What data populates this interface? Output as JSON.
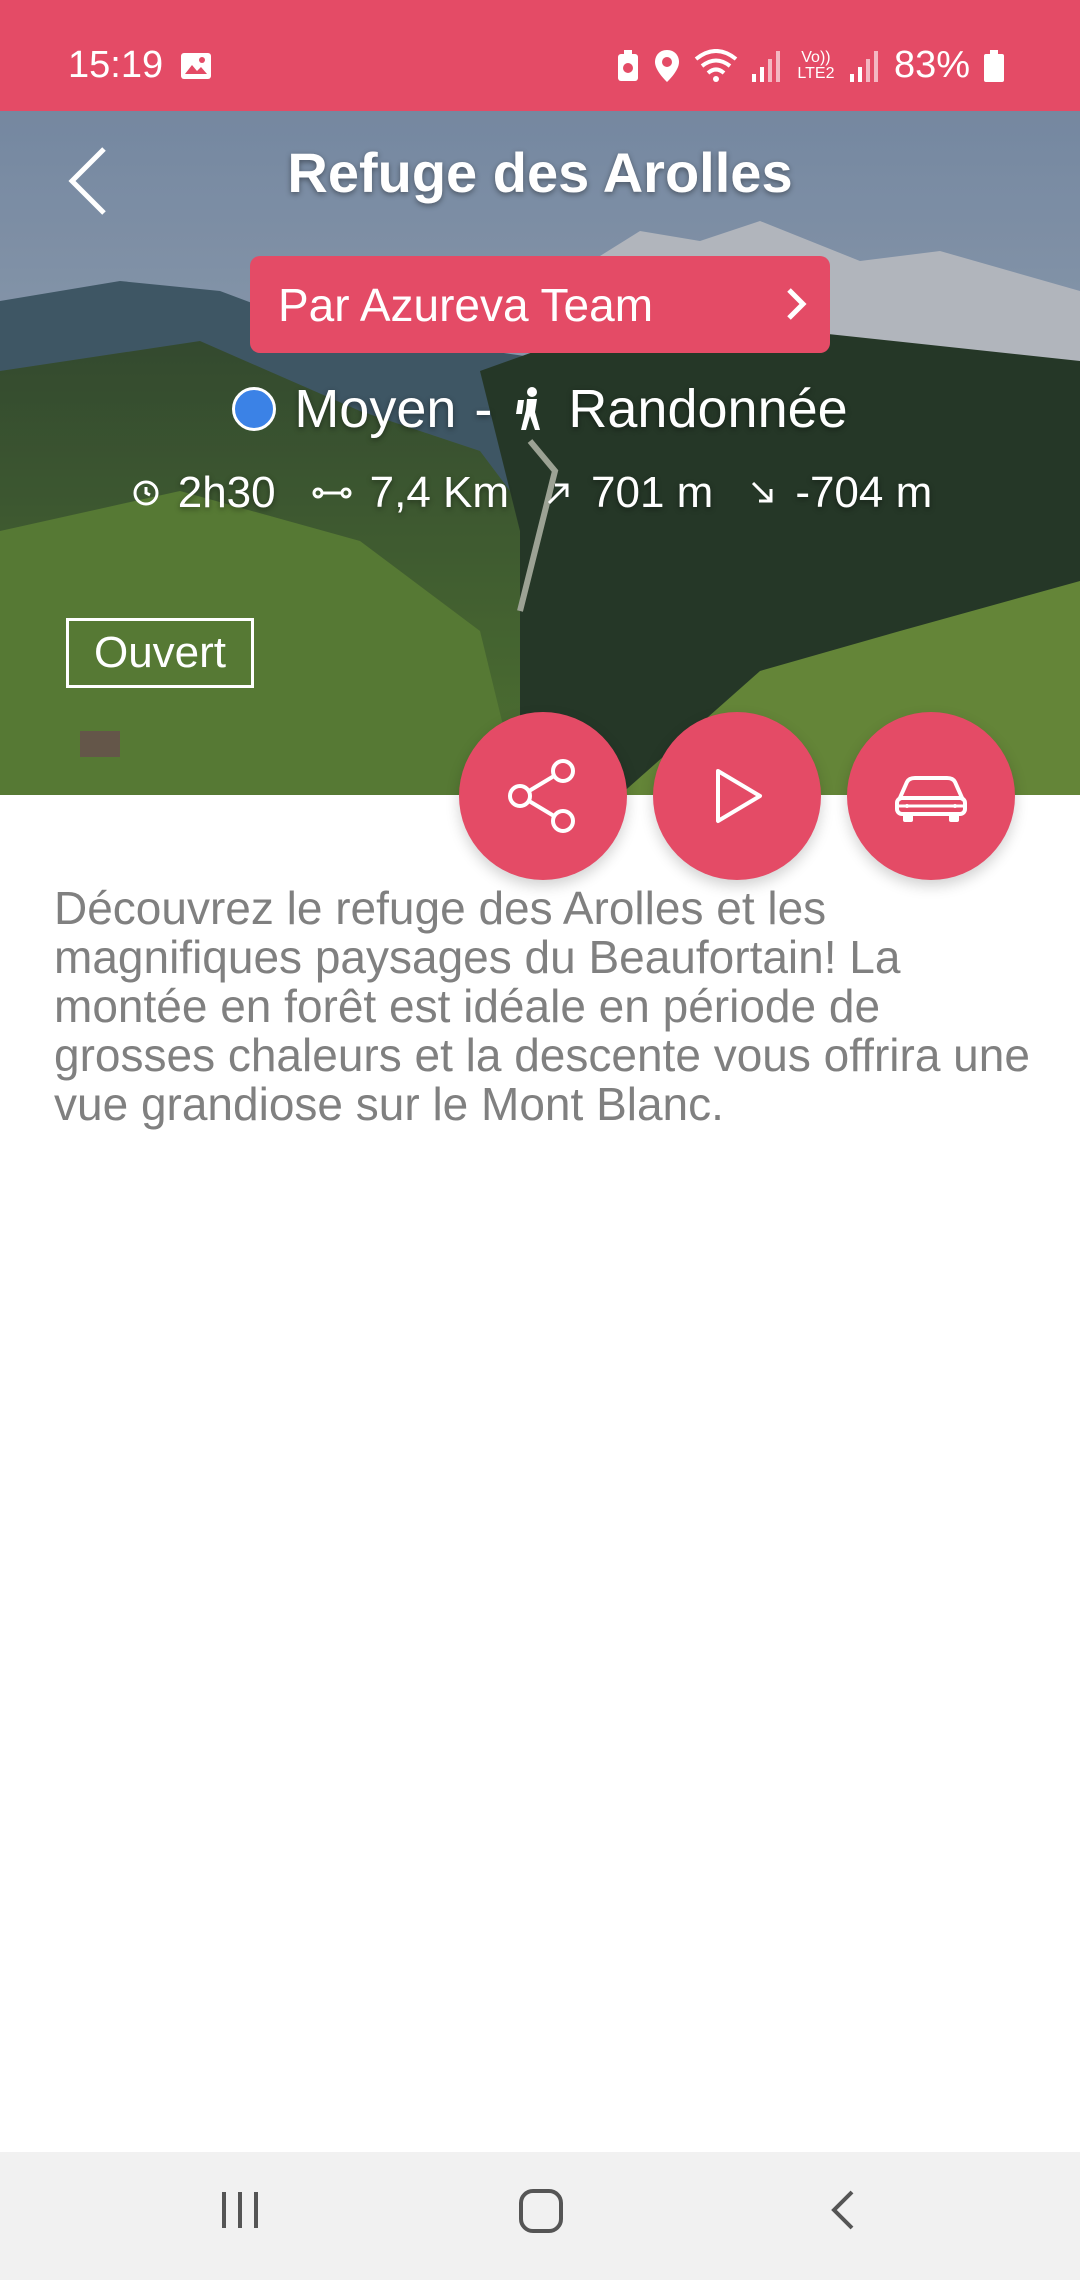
{
  "status_bar": {
    "time": "15:19",
    "battery": "83%",
    "network": "Vo)) LTE2",
    "icons": [
      "image-icon",
      "battery-saver-icon",
      "location-icon",
      "wifi-icon",
      "signal-icon",
      "signal-icon",
      "battery-icon"
    ]
  },
  "header": {
    "title": "Refuge des Arolles",
    "back_icon": "chevron-left-icon"
  },
  "author_button": {
    "label": "Par Azureva Team",
    "icon": "chevron-right-icon"
  },
  "meta": {
    "difficulty": "Moyen",
    "separator": "-",
    "activity": "Randonnée",
    "difficulty_color": "#3b82e6"
  },
  "stats": {
    "duration": "2h30",
    "distance": "7,4 Km",
    "ascent": "701 m",
    "descent": "-704 m"
  },
  "status_badge": "Ouvert",
  "actions": [
    {
      "name": "share",
      "icon": "share-icon"
    },
    {
      "name": "play",
      "icon": "play-icon"
    },
    {
      "name": "car",
      "icon": "car-icon"
    }
  ],
  "description": "Découvrez le refuge des Arolles et les magnifiques paysages du Beaufortain! La montée en forêt est idéale en période de grosses chaleurs et la descente vous offrira une vue grandiose sur le Mont Blanc.",
  "colors": {
    "accent": "#e44b66",
    "text_muted": "#808080",
    "nav_bg": "#f1f1f1"
  }
}
